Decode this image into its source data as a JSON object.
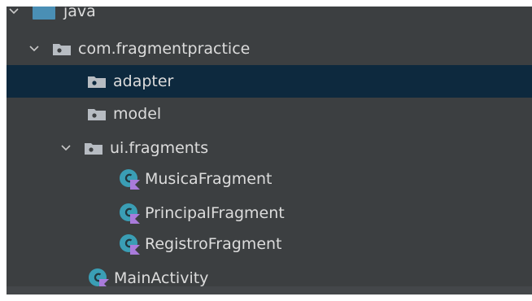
{
  "tree": {
    "java": {
      "label": "java"
    },
    "package": {
      "label": "com.fragmentpractice"
    },
    "adapter": {
      "label": "adapter"
    },
    "model": {
      "label": "model"
    },
    "ui_fragments": {
      "label": "ui.fragments"
    },
    "musica": {
      "label": "MusicaFragment"
    },
    "principal": {
      "label": "PrincipalFragment"
    },
    "registro": {
      "label": "RegistroFragment"
    },
    "main_activity": {
      "label": "MainActivity"
    }
  },
  "colors": {
    "panel_bg": "#3c3f41",
    "selection_bg": "#0d293e",
    "text": "#dcdcdc",
    "source_folder": "#4a8fb5",
    "folder": "#b7bcc2",
    "class_teal": "#3a9eb5",
    "kotlin_purple": "#a97bdb"
  },
  "icons": {
    "expanded": "chevron-down-icon",
    "source_folder": "source-folder-icon",
    "package": "package-folder-icon",
    "kotlin_class": "kotlin-class-icon"
  }
}
